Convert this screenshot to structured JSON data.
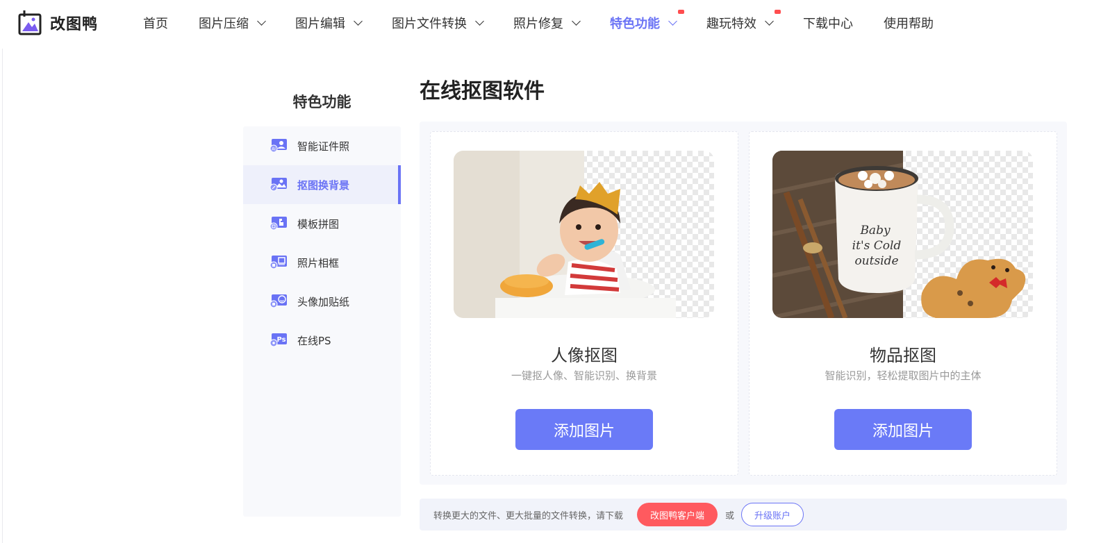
{
  "brand": {
    "name": "改图鸭",
    "accent": "#6a73f5"
  },
  "nav": {
    "items": [
      {
        "label": "首页",
        "dropdown": false,
        "active": false,
        "badge": false
      },
      {
        "label": "图片压缩",
        "dropdown": true,
        "active": false,
        "badge": false
      },
      {
        "label": "图片编辑",
        "dropdown": true,
        "active": false,
        "badge": false
      },
      {
        "label": "图片文件转换",
        "dropdown": true,
        "active": false,
        "badge": false
      },
      {
        "label": "照片修复",
        "dropdown": true,
        "active": false,
        "badge": false
      },
      {
        "label": "特色功能",
        "dropdown": true,
        "active": true,
        "badge": true
      },
      {
        "label": "趣玩特效",
        "dropdown": true,
        "active": false,
        "badge": true
      },
      {
        "label": "下载中心",
        "dropdown": false,
        "active": false,
        "badge": false
      },
      {
        "label": "使用帮助",
        "dropdown": false,
        "active": false,
        "badge": false
      }
    ]
  },
  "sidebar": {
    "title": "特色功能",
    "items": [
      {
        "label": "智能证件照",
        "icon": "id-photo-icon",
        "active": false
      },
      {
        "label": "抠图换背景",
        "icon": "cutout-background-icon",
        "active": true
      },
      {
        "label": "模板拼图",
        "icon": "template-collage-icon",
        "active": false
      },
      {
        "label": "照片相框",
        "icon": "photo-frame-icon",
        "active": false
      },
      {
        "label": "头像加贴纸",
        "icon": "avatar-sticker-icon",
        "active": false
      },
      {
        "label": "在线PS",
        "icon": "online-ps-icon",
        "active": false
      }
    ]
  },
  "main": {
    "title": "在线抠图软件",
    "cards": [
      {
        "title": "人像抠图",
        "desc": "一键抠人像、智能识别、换背景",
        "button": "添加图片",
        "image": "portrait-cutout-image"
      },
      {
        "title": "物品抠图",
        "desc": "智能识别，轻松提取图片中的主体",
        "button": "添加图片",
        "image": "object-cutout-image"
      }
    ]
  },
  "notice": {
    "text": "转换更大的文件、更大批量的文件转换，请下载",
    "client_button": "改图鸭客户端",
    "or": "或",
    "upgrade_button": "升级账户"
  }
}
